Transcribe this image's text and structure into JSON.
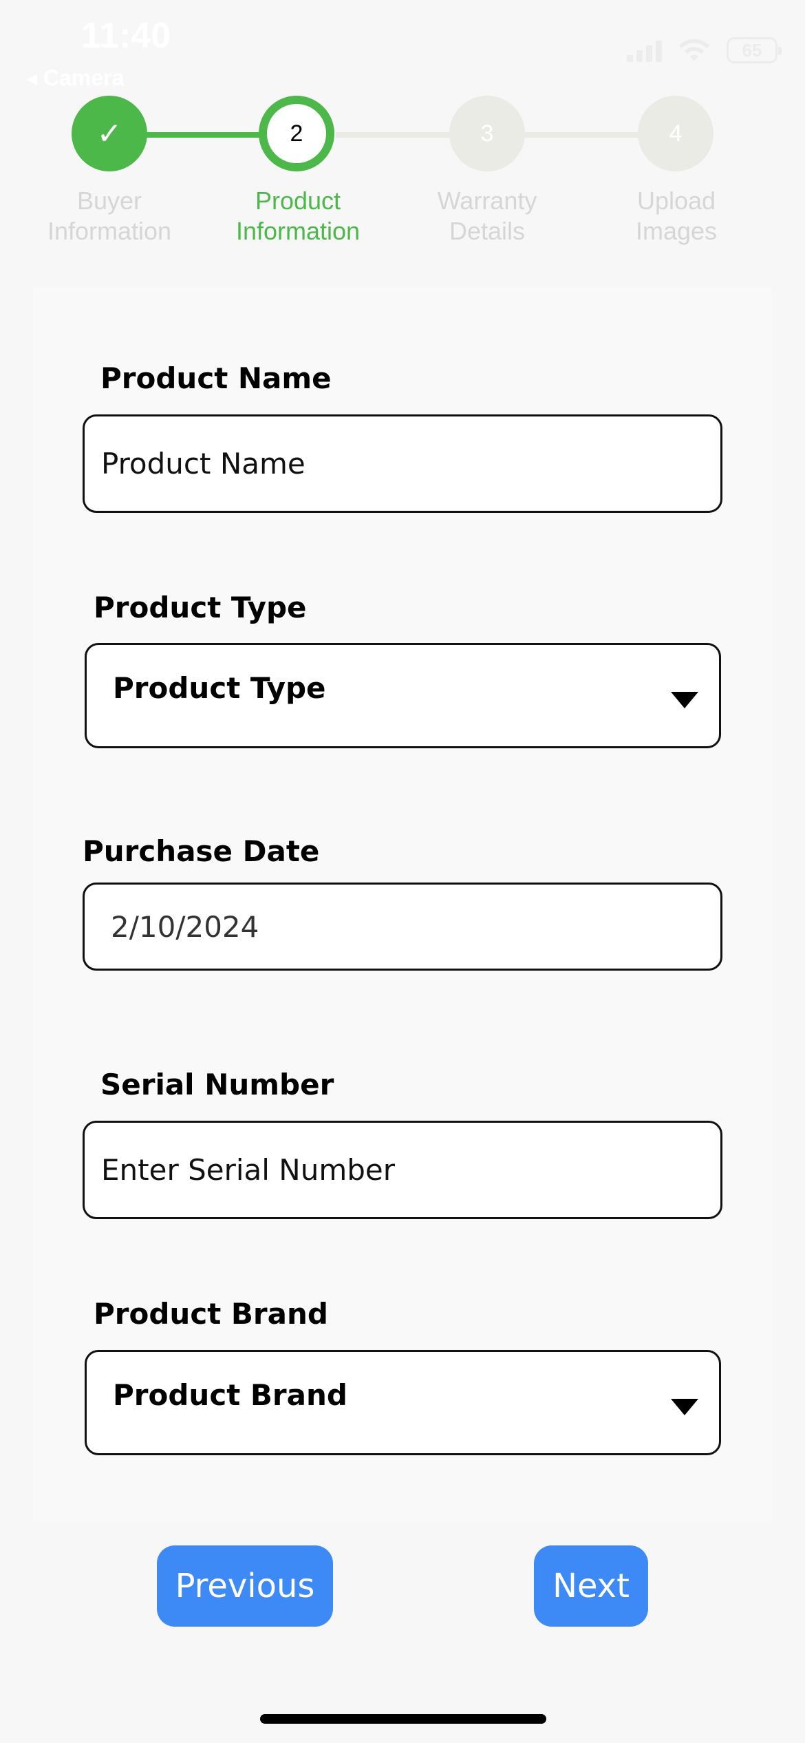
{
  "status_bar": {
    "time": "11:40",
    "back_label": "◂ Camera",
    "battery": "65"
  },
  "stepper": {
    "steps": [
      {
        "number": "✓",
        "line1": "Buyer",
        "line2": "Information",
        "state": "done"
      },
      {
        "number": "2",
        "line1": "Product",
        "line2": "Information",
        "state": "active"
      },
      {
        "number": "3",
        "line1": "Warranty",
        "line2": "Details",
        "state": "todo"
      },
      {
        "number": "4",
        "line1": "Upload",
        "line2": "Images",
        "state": "todo"
      }
    ],
    "colors": {
      "accent": "#4cb84a",
      "inactive": "#ebebe6"
    }
  },
  "form": {
    "product_name": {
      "label": "Product Name",
      "placeholder": "Product Name"
    },
    "product_type": {
      "label": "Product Type",
      "selected": "Product Type"
    },
    "purchase_date": {
      "label": "Purchase Date",
      "value": "2/10/2024"
    },
    "serial_number": {
      "label": "Serial Number",
      "placeholder": "Enter Serial Number"
    },
    "product_brand": {
      "label": "Product Brand",
      "selected": "Product Brand"
    }
  },
  "buttons": {
    "previous": "Previous",
    "next": "Next",
    "color": "#3d8af7"
  }
}
